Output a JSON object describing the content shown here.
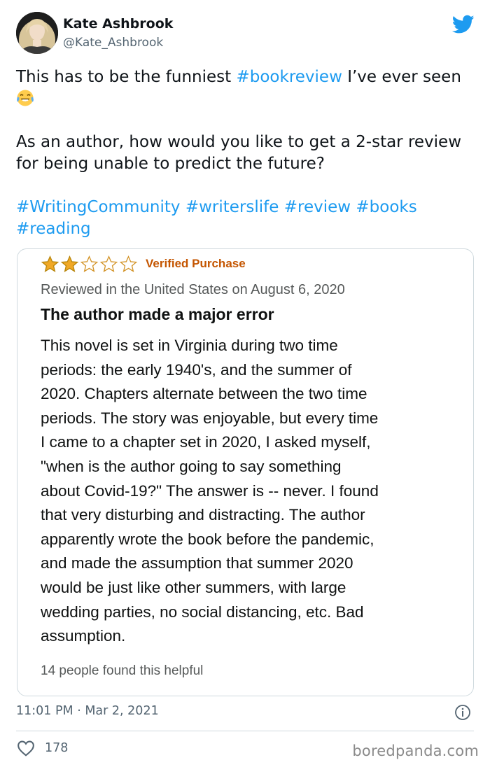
{
  "author": {
    "name": "Kate Ashbrook",
    "handle": "@Kate_Ashbrook"
  },
  "tweet": {
    "line1_text": "This has to be the funniest ",
    "line1_hashtag": "#bookreview",
    "line1_after": " I’ve ever seen ",
    "emoji_icon": "face-with-tears-of-joy-icon",
    "paragraph2": "As an author, how would you like to get a 2-star review for being unable to predict the future?",
    "hashtags": [
      "#WritingCommunity",
      "#writerslife",
      "#review",
      "#books",
      "#reading"
    ]
  },
  "review": {
    "rating": 2,
    "max_rating": 5,
    "badge": "Verified Purchase",
    "reviewed_line": "Reviewed in the United States on August 6, 2020",
    "title": "The author made a major error",
    "body_lines": [
      "This novel is set in Virginia during two time",
      "periods: the early 1940's, and the summer of",
      "2020. Chapters alternate between the two time",
      "periods. The story was enjoyable, but every time",
      "I came to a chapter set in 2020, I asked myself,",
      "\"when is the author going to say something",
      "about Covid-19?\" The answer is -- never. I found",
      "that very disturbing and distracting. The author",
      "apparently wrote the book before the pandemic,",
      "and made the assumption that summer 2020",
      "would be just like other summers, with large",
      "wedding parties, no social distancing, etc. Bad",
      "assumption."
    ],
    "helpful": "14 people found this helpful",
    "star_color": "#f0a826"
  },
  "meta": {
    "timestamp": "11:01 PM · Mar 2, 2021",
    "likes": "178",
    "watermark": "boredpanda.com"
  },
  "colors": {
    "link": "#1d9bf0",
    "badge": "#c45500"
  }
}
